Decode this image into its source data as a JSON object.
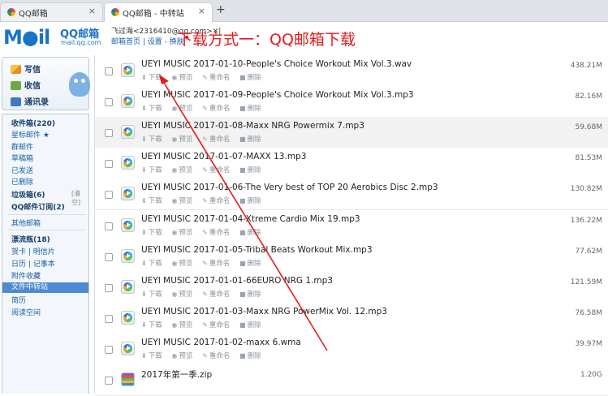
{
  "browser": {
    "tabs": [
      {
        "title": "QQ邮箱",
        "close": "×"
      },
      {
        "title": "QQ邮箱 - 中转站",
        "close": "×"
      }
    ],
    "new_tab": "+"
  },
  "header": {
    "logo_text": "M●il",
    "logo_cn": "QQ邮箱",
    "logo_url": "mail.qq.com",
    "user": "飞过海<2316410@qq.com>",
    "user_suffix": "✕|",
    "links": "邮箱首页 | 设置 - 换肤"
  },
  "annotation": "下载方式一：QQ邮箱下载",
  "sidebar": {
    "write": "写信",
    "inbox": "收信",
    "contacts": "通讯录",
    "folders": [
      {
        "label": "收件箱(220)",
        "bold": true
      },
      {
        "label": "星标邮件 ★",
        "bold": false
      },
      {
        "label": "群邮件",
        "bold": false
      },
      {
        "label": "草稿箱",
        "bold": false
      },
      {
        "label": "已发送",
        "bold": false
      },
      {
        "label": "已删除",
        "bold": false
      },
      {
        "label": "垃圾箱(6)",
        "bold": true
      },
      {
        "label": "QQ邮件订阅(2)",
        "bold": true
      }
    ],
    "clear_label": "[清空]",
    "other": "其他邮箱",
    "extras": [
      {
        "label": "漂流瓶(18)",
        "bold": true
      },
      {
        "label": "贺卡 | 明信片",
        "bold": false
      },
      {
        "label": "日历 | 记事本",
        "bold": false
      },
      {
        "label": "附件收藏",
        "bold": false
      },
      {
        "label": "文件中转站",
        "bold": false,
        "active": true
      },
      {
        "label": "简历",
        "bold": false
      },
      {
        "label": "阅读空间",
        "bold": false
      }
    ]
  },
  "file_actions": {
    "download": "下载",
    "preview": "预览",
    "rename": "重命名",
    "delete": "删除"
  },
  "files": [
    {
      "name": "UEYI MUSIC 2017-01-10-People's Choice Workout Mix Vol.3.wav",
      "size": "438.21M",
      "icon": "media"
    },
    {
      "name": "UEYI MUSIC 2017-01-09-People's Choice Workout Mix Vol.3.mp3",
      "size": "82.16M",
      "icon": "media"
    },
    {
      "name": "UEYI MUSIC 2017-01-08-Maxx NRG Powermix 7.mp3",
      "size": "59.68M",
      "icon": "media"
    },
    {
      "name": "UEYI MUSIC 2017-01-07-MAXX 13.mp3",
      "size": "81.53M",
      "icon": "media"
    },
    {
      "name": "UEYI MUSIC 2017-01-06-The Very best of TOP 20 Aerobics Disc 2.mp3",
      "size": "130.82M",
      "icon": "media"
    },
    {
      "name": "UEYI MUSIC 2017-01-04-Xtreme Cardio Mix 19.mp3",
      "size": "136.22M",
      "icon": "media"
    },
    {
      "name": "UEYI MUSIC 2017-01-05-Tribal Beats Workout Mix.mp3",
      "size": "77.62M",
      "icon": "media"
    },
    {
      "name": "UEYI MUSIC 2017-01-01-66EURO NRG 1.mp3",
      "size": "121.59M",
      "icon": "media"
    },
    {
      "name": "UEYI MUSIC 2017-01-03-Maxx NRG PowerMix Vol. 12.mp3",
      "size": "76.58M",
      "icon": "media"
    },
    {
      "name": "UEYI MUSIC 2017-01-02-maxx 6.wma",
      "size": "39.97M",
      "icon": "media"
    },
    {
      "name": "2017年第一季.zip",
      "size": "1.20G",
      "icon": "zip"
    }
  ],
  "colors": {
    "accent": "#1a73c8",
    "annotation": "#e21d1d",
    "active_folder": "#4d8ad1"
  }
}
